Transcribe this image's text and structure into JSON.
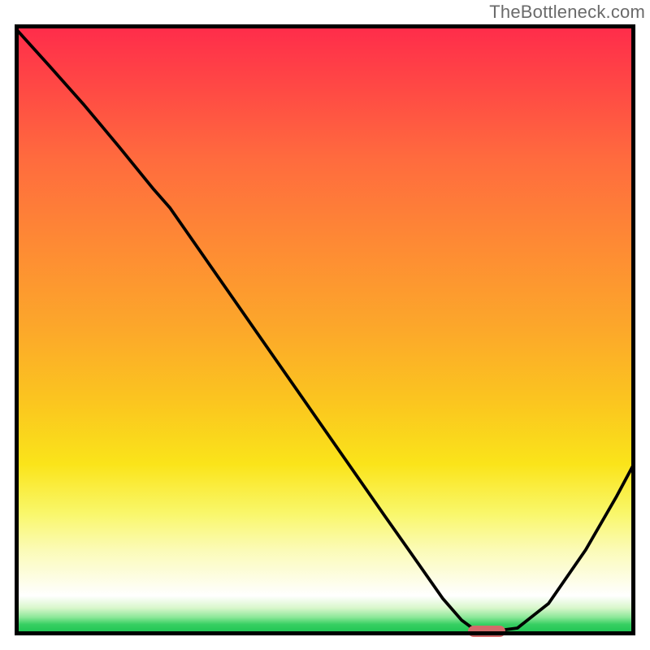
{
  "watermark": "TheBottleneck.com",
  "chart_data": {
    "type": "line",
    "title": "",
    "xlabel": "",
    "ylabel": "",
    "x": [
      0.0,
      0.056,
      0.112,
      0.168,
      0.224,
      0.25,
      0.32,
      0.39,
      0.46,
      0.53,
      0.6,
      0.65,
      0.69,
      0.72,
      0.74,
      0.78,
      0.81,
      0.86,
      0.92,
      0.97,
      1.0
    ],
    "y": [
      0.995,
      0.932,
      0.868,
      0.8,
      0.73,
      0.7,
      0.598,
      0.496,
      0.394,
      0.292,
      0.19,
      0.118,
      0.06,
      0.025,
      0.01,
      0.008,
      0.012,
      0.052,
      0.14,
      0.228,
      0.285
    ],
    "xlim": [
      0,
      1
    ],
    "ylim": [
      0,
      1
    ],
    "marker_x": 0.76,
    "marker_y": 0.006,
    "grid": false,
    "series_color": "#000000",
    "background_gradient": [
      "#ff2b4b",
      "#fbc61f",
      "#f9f76a",
      "#ffffff",
      "#15c24e"
    ],
    "annotations": []
  }
}
